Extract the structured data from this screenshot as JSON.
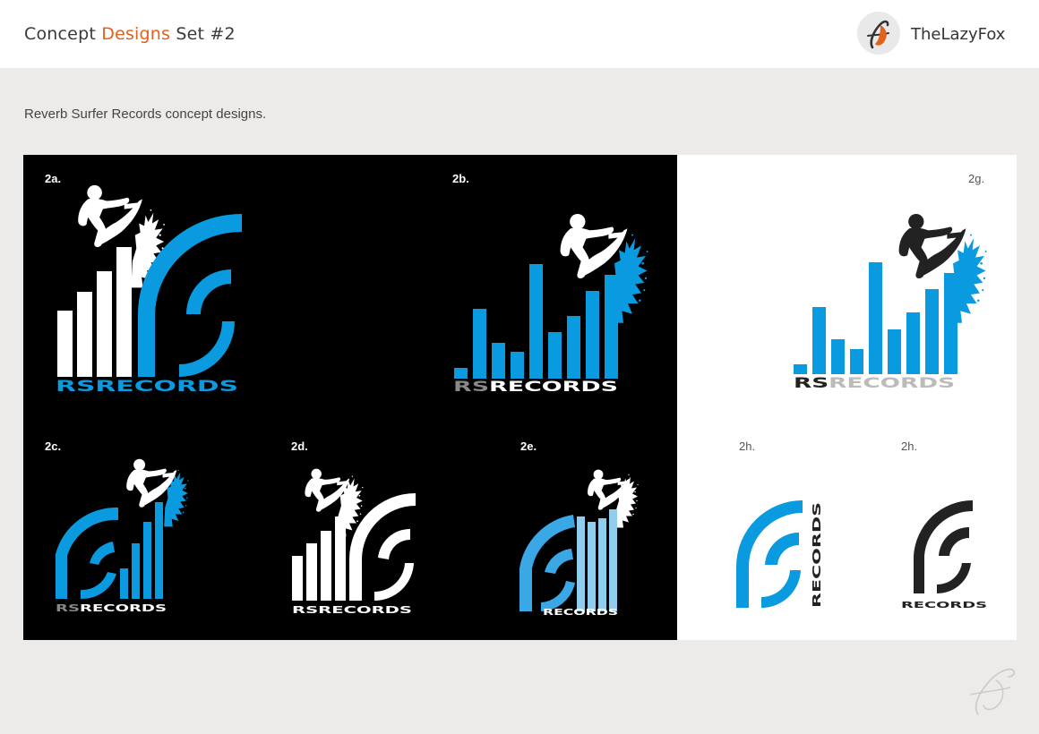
{
  "header": {
    "title_part1": "Concept",
    "title_accent": "Designs",
    "title_part2": "Set #2",
    "brand_name": "TheLazyFox",
    "brand_logo_icon": "lazyfox-logo-icon"
  },
  "subtitle": "Reverb Surfer Records concept designs.",
  "colors": {
    "accent_orange": "#e0621c",
    "blue": "#0a9ae0",
    "light_blue": "#8fcdee",
    "dark": "#000000",
    "charcoal": "#222222",
    "grey": "#888888"
  },
  "designs": [
    {
      "id": "2a",
      "label": "2a.",
      "wordmark_prefix": "RS",
      "wordmark_suffix": "RECORDS"
    },
    {
      "id": "2b",
      "label": "2b.",
      "wordmark_prefix": "RS",
      "wordmark_suffix": "RECORDS"
    },
    {
      "id": "2g",
      "label": "2g.",
      "wordmark_prefix": "RS",
      "wordmark_suffix": "RECORDS"
    },
    {
      "id": "2c",
      "label": "2c.",
      "wordmark_prefix": "RS",
      "wordmark_suffix": "RECORDS"
    },
    {
      "id": "2d",
      "label": "2d.",
      "wordmark_prefix": "RS",
      "wordmark_suffix": "RECORDS"
    },
    {
      "id": "2e",
      "label": "2e.",
      "wordmark_prefix": "",
      "wordmark_suffix": "RECORDS"
    },
    {
      "id": "2h_color",
      "label": "2h.",
      "wordmark_prefix": "",
      "wordmark_suffix": "RECORDS"
    },
    {
      "id": "2h_mono",
      "label": "2h.",
      "wordmark_prefix": "",
      "wordmark_suffix": "RECORDS"
    }
  ],
  "watermark_icon": "lazyfox-watermark-icon"
}
